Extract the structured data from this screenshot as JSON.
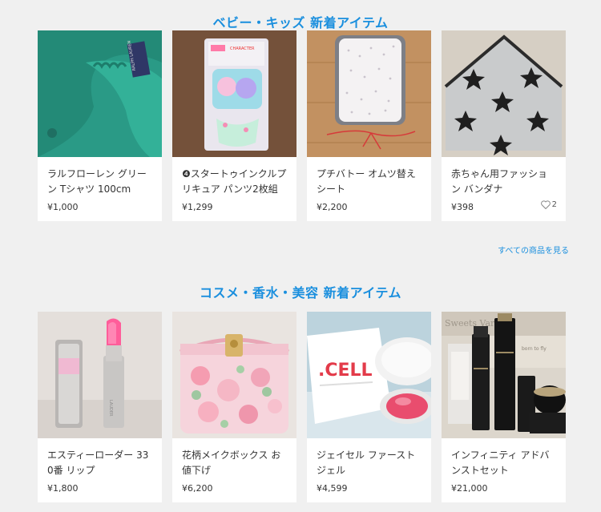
{
  "sections": [
    {
      "title": "ベビー・キッズ 新着アイテム",
      "see_all": "すべての商品を見る",
      "items": [
        {
          "name": "ラルフローレン グリーン Tシャツ 100cm",
          "price": "¥1,000",
          "thumb": "green-polo-shirt"
        },
        {
          "name": "❹スタートゥインクルプリキュア パンツ2枚組",
          "price": "¥1,299",
          "thumb": "precure-underwear-pack"
        },
        {
          "name": "プチバトー オムツ替えシート",
          "price": "¥2,200",
          "thumb": "diaper-changing-sheet"
        },
        {
          "name": "赤ちゃん用ファッション バンダナ",
          "price": "¥398",
          "thumb": "star-bandana",
          "likes": "2"
        }
      ]
    },
    {
      "title": "コスメ・香水・美容 新着アイテム",
      "items": [
        {
          "name": "エスティーローダー 330番 リップ",
          "price": "¥1,800",
          "thumb": "pink-lipstick"
        },
        {
          "name": "花柄メイクボックス お値下げ",
          "price": "¥6,200",
          "thumb": "floral-vanity-case"
        },
        {
          "name": "ジェイセル ファーストジェル",
          "price": "¥4,599",
          "thumb": "cell-gel-box"
        },
        {
          "name": "インフィニティ アドバンストセット",
          "price": "¥21,000",
          "thumb": "infinity-skincare-set"
        }
      ]
    }
  ],
  "colors": {
    "accent": "#1a8fde",
    "background": "#f0f0f0",
    "card": "#ffffff"
  },
  "icons": {
    "like": "heart-outline-icon"
  }
}
